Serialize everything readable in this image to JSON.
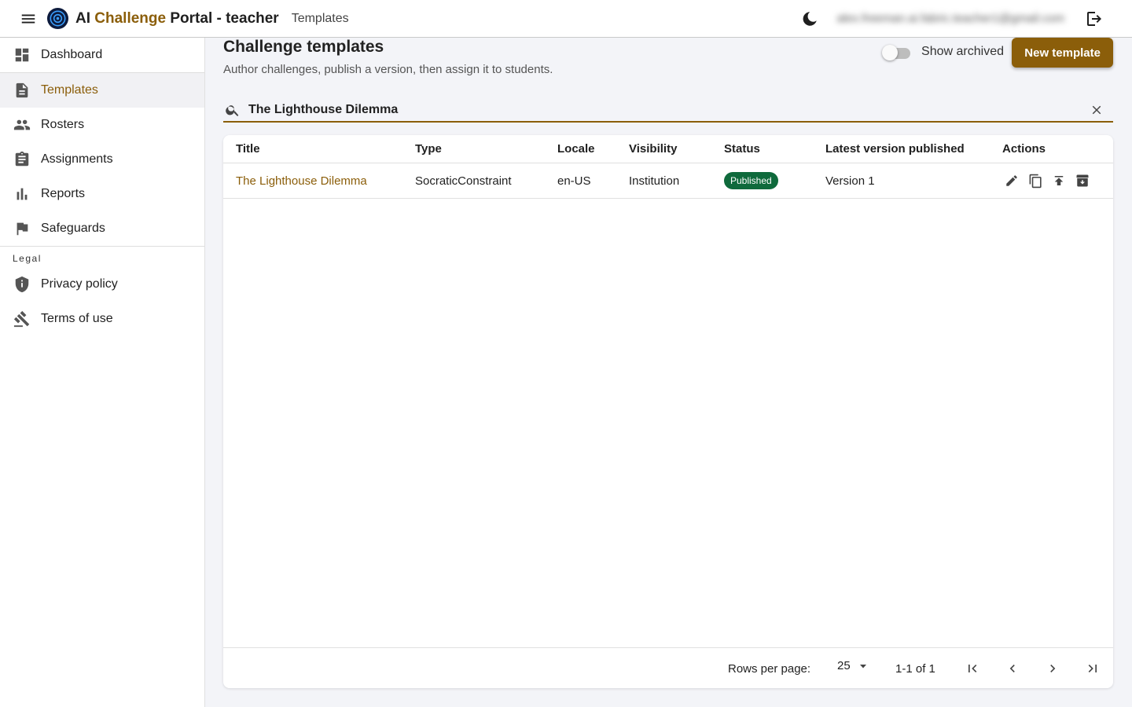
{
  "app": {
    "brand_prefix": "AI",
    "brand_accent": "Challenge",
    "brand_suffix": "Portal - teacher",
    "breadcrumb": "Templates",
    "user_email": "alex.freeman.ai.fabric.teacher1@gmail.com"
  },
  "sidebar": {
    "items": [
      {
        "label": "Dashboard",
        "icon": "dashboard-icon"
      },
      {
        "label": "Templates",
        "icon": "document-icon"
      },
      {
        "label": "Rosters",
        "icon": "people-icon"
      },
      {
        "label": "Assignments",
        "icon": "clipboard-icon"
      },
      {
        "label": "Reports",
        "icon": "bar-chart-icon"
      },
      {
        "label": "Safeguards",
        "icon": "flag-icon"
      }
    ],
    "legal_header": "Legal",
    "legal_items": [
      {
        "label": "Privacy policy",
        "icon": "shield-icon"
      },
      {
        "label": "Terms of use",
        "icon": "gavel-icon"
      }
    ]
  },
  "page": {
    "title": "Challenge templates",
    "subtitle": "Author challenges, publish a version, then assign it to students.",
    "show_archived_label": "Show archived",
    "new_template_label": "New template"
  },
  "search": {
    "value": "The Lighthouse Dilemma"
  },
  "table": {
    "columns": [
      "Title",
      "Type",
      "Locale",
      "Visibility",
      "Status",
      "Latest version published",
      "Actions"
    ],
    "rows": [
      {
        "title": "The Lighthouse Dilemma",
        "type": "SocraticConstraint",
        "locale": "en-US",
        "visibility": "Institution",
        "status": "Published",
        "latest": "Version 1"
      }
    ]
  },
  "pagination": {
    "rows_per_page_label": "Rows per page:",
    "rows_per_page": "25",
    "range": "1-1 of 1"
  },
  "colors": {
    "accent": "#8b5e0a",
    "published": "#0f6a3c"
  }
}
